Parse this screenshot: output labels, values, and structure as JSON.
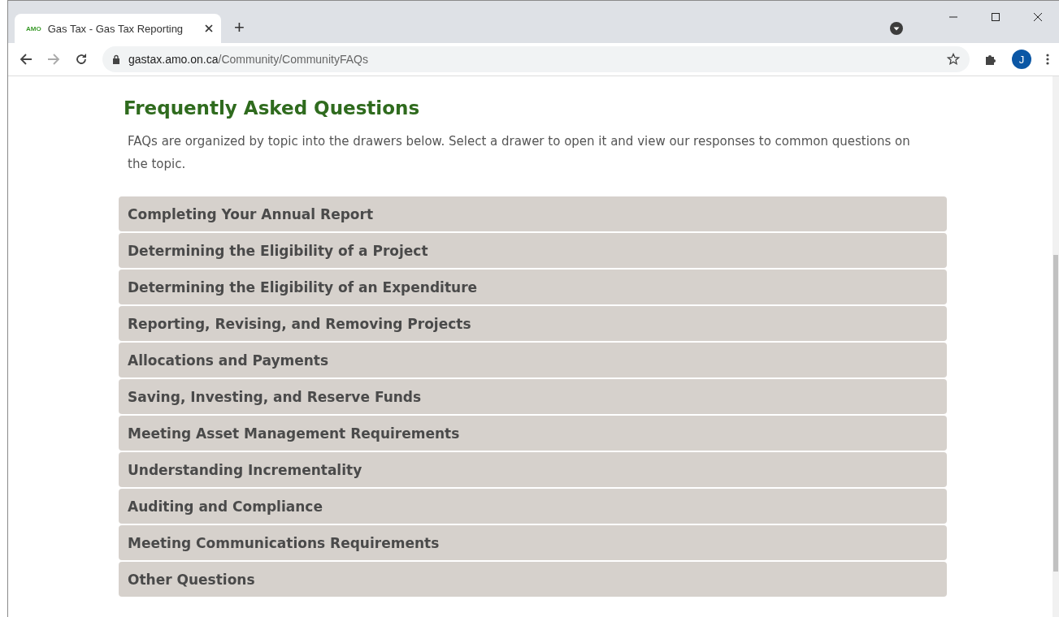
{
  "browser": {
    "tabs": [
      {
        "favicon_text": "AMO",
        "title": "Gas Tax - Gas Tax Reporting",
        "selected": true
      }
    ],
    "new_tab": "+",
    "url": {
      "host": "gastax.amo.on.ca",
      "path": "/Community/CommunityFAQs"
    },
    "profile_initial": "J"
  },
  "page": {
    "heading": "Frequently Asked Questions",
    "intro": "FAQs are organized by topic into the drawers below. Select a drawer to open it and view our responses to common questions on the topic.",
    "drawers": [
      {
        "title": "Completing Your Annual Report",
        "expanded": false
      },
      {
        "title": "Determining the Eligibility of a Project",
        "expanded": false
      },
      {
        "title": "Determining the Eligibility of an Expenditure",
        "expanded": false
      },
      {
        "title": "Reporting, Revising, and Removing Projects",
        "expanded": false
      },
      {
        "title": "Allocations and Payments",
        "expanded": false
      },
      {
        "title": "Saving, Investing, and Reserve Funds",
        "expanded": false
      },
      {
        "title": "Meeting Asset Management Requirements",
        "expanded": false
      },
      {
        "title": "Understanding Incrementality",
        "expanded": false
      },
      {
        "title": "Auditing and Compliance",
        "expanded": false
      },
      {
        "title": "Meeting Communications Requirements",
        "expanded": false
      },
      {
        "title": "Other Questions",
        "expanded": false
      }
    ]
  }
}
